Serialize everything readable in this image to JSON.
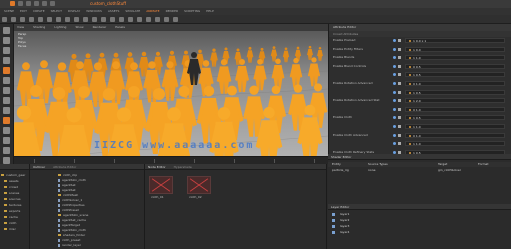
{
  "window": {
    "title": "custom_clothStuff"
  },
  "menubar": {
    "items": [
      "SCENE",
      "EDIT",
      "CREATE",
      "SELECT",
      "DISPLAY",
      "WINDOWS",
      "ASSETS",
      "SIMULATE",
      "ANIMATE",
      "RENDER",
      "SCRIPTING",
      "HELP"
    ]
  },
  "viewport": {
    "menu": [
      "View",
      "Shading",
      "Lighting",
      "Show",
      "Renderer",
      "Panels"
    ],
    "info": [
      "Persp",
      "Top",
      "Polys",
      "Faces"
    ],
    "watermark": "IIZCG   www.aaaaaa.com"
  },
  "attributes": {
    "header": "Attribute Editor",
    "tabs": "Crowd Attributes",
    "rows": [
      {
        "label": "Enable Preload",
        "value": "1 0.0 x 1"
      },
      {
        "label": "Enable Entity Filters",
        "value": "1 0.0"
      },
      {
        "label": "Enable Blends",
        "value": "1 1.0"
      },
      {
        "label": "Enable Blend Controls",
        "value": "0 0.5"
      },
      {
        "label": "",
        "value": "1 0.5"
      },
      {
        "label": "Enable Rotation Advanced",
        "value": "0 1.0"
      },
      {
        "label": "",
        "value": "1 0.5"
      },
      {
        "label": "Enable Rotation Advanced Stat",
        "value": "1 2.0"
      },
      {
        "label": "",
        "value": "0 1.0"
      },
      {
        "label": "Enable Cloth",
        "value": "1 0.5"
      },
      {
        "label": "",
        "value": "1 1.0"
      },
      {
        "label": "Enable Cloth Advanced",
        "value": "0 1.0"
      },
      {
        "label": "",
        "value": "1 1.0"
      },
      {
        "label": "Enable Cloth Refinery Stats",
        "value": "1 0.5"
      }
    ]
  },
  "outliner": {
    "tabs": [
      "Outliner",
      "Attribute Editor"
    ],
    "tree": [
      "custom_gear",
      "assets",
      "crowd",
      "scenes",
      "sources",
      "textures",
      "exports",
      "cache",
      "cloth",
      "misc"
    ],
    "files": [
      "cloth_clip",
      "agentSkin_cloth",
      "agentSet",
      "agentSet",
      "clothMesh",
      "clothSolver_1",
      "clothProperties",
      "clothPreset",
      "agentSkin_scene",
      "agentSet_cache",
      "agentTarget",
      "agentSkin_cloth",
      "shaders_folder",
      "cloth_preset",
      "render_layer"
    ]
  },
  "thumbs": {
    "tabs": [
      "Node Editor",
      "Hypershade"
    ],
    "items": [
      "cloth_01",
      "cloth_02"
    ]
  },
  "right_bottom": {
    "header": "Shader Editor",
    "columns": [
      "Entity",
      "Source Types",
      "Target",
      "Format"
    ],
    "row": [
      "particle_rig",
      "none",
      "gin_clothSolver"
    ],
    "header2": "Layer Editor",
    "layers": [
      "layer1",
      "layer2",
      "layer3",
      "layer4"
    ]
  },
  "colors": {
    "accent": "#e07a2a",
    "watermark": "#4678c8",
    "crowd": "#f0a020"
  }
}
